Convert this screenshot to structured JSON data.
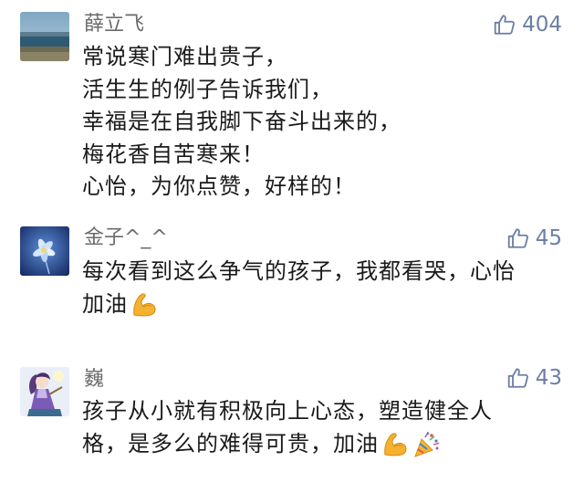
{
  "comments": [
    {
      "author": "薛立飞",
      "likes": "404",
      "avatar_icon": "lake-landscape-avatar",
      "lines": [
        "常说寒门难出贵子，",
        "活生生的例子告诉我们，",
        "幸福是在自我脚下奋斗出来的，",
        "梅花香自苦寒来！",
        "心怡，为你点赞，好样的！"
      ]
    },
    {
      "author": "金子^_^",
      "likes": "45",
      "avatar_icon": "blue-flower-avatar",
      "lines": [
        "每次看到这么争气的孩子，我都看哭，心怡",
        "加油"
      ],
      "emojis": [
        "flexed-biceps-icon"
      ]
    },
    {
      "author": "巍",
      "likes": "43",
      "avatar_icon": "anime-girl-avatar",
      "lines": [
        "孩子从小就有积极向上心态，塑造健全人",
        "格，是多么的难得可贵，加油"
      ],
      "emojis": [
        "flexed-biceps-icon",
        "party-popper-icon"
      ]
    }
  ],
  "colors": {
    "author": "#6b6b6b",
    "like": "#6b7ea6",
    "text": "#1a1a1a"
  }
}
